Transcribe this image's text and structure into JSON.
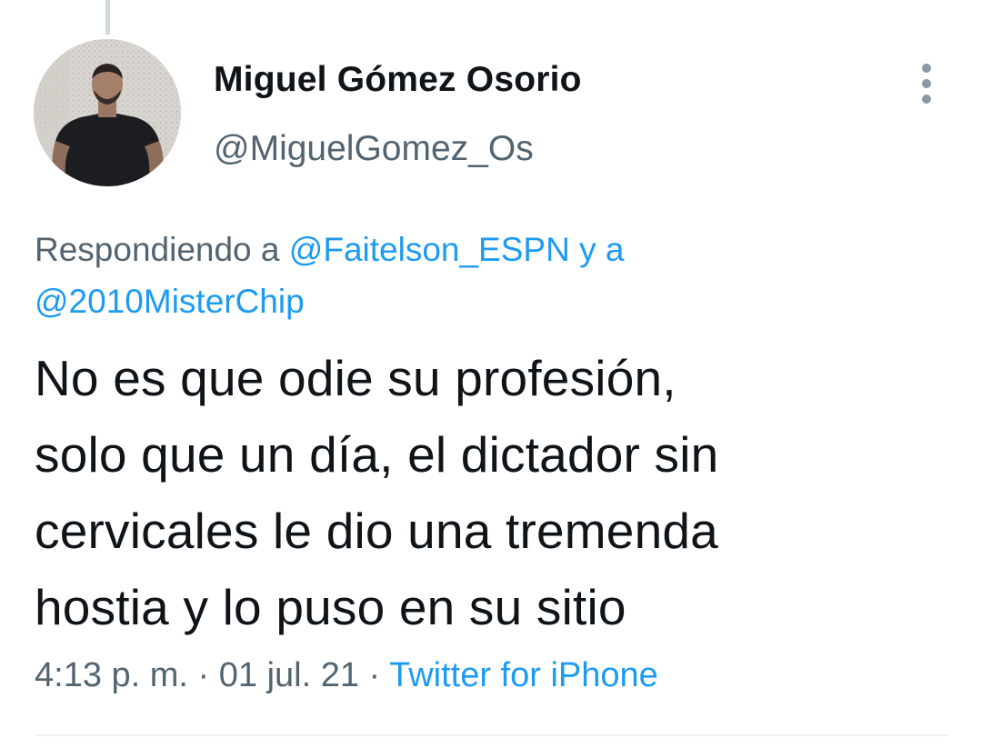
{
  "author": {
    "display_name": "Miguel Gómez Osorio",
    "handle": "@MiguelGomez_Os",
    "avatar_icon": "profile-photo"
  },
  "more_icon": "more-vertical-icon",
  "reply": {
    "prefix": "Respondiendo a ",
    "mention_1": "@Faitelson_ESPN",
    "connector": " y a",
    "mention_2": "@2010MisterChip"
  },
  "tweet": {
    "lines": [
      "No es que odie su profesión,",
      "solo que un día, el dictador sin",
      "cervicales le dio una tremenda",
      "hostia y lo puso en su sitio"
    ]
  },
  "meta": {
    "time": "4:13 p. m.",
    "separator_1": " · ",
    "date": "01 jul. 21",
    "separator_2": " · ",
    "source": "Twitter for iPhone"
  },
  "colors": {
    "text_primary": "#0f1419",
    "text_secondary": "#536471",
    "accent": "#1d9bf0",
    "divider": "#eff3f4"
  }
}
